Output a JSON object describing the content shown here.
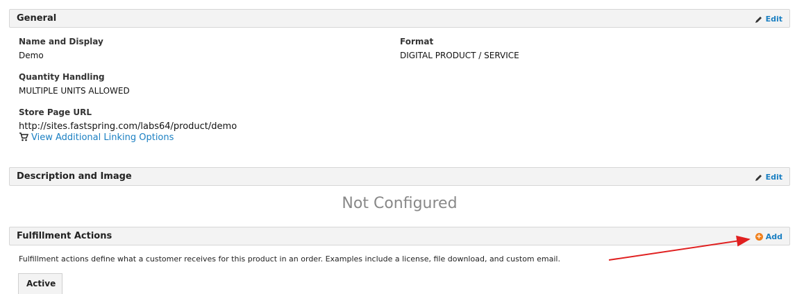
{
  "general": {
    "title": "General",
    "edit_label": "Edit",
    "fields": {
      "name_label": "Name and Display",
      "name_value": "Demo",
      "format_label": "Format",
      "format_value": "DIGITAL PRODUCT / SERVICE",
      "quantity_label": "Quantity Handling",
      "quantity_value": "MULTIPLE UNITS ALLOWED",
      "url_label": "Store Page URL",
      "url_value": "http://sites.fastspring.com/labs64/product/demo",
      "linking_link": "View Additional Linking Options"
    }
  },
  "description": {
    "title": "Description and Image",
    "edit_label": "Edit",
    "status": "Not Configured"
  },
  "fulfillment": {
    "title": "Fulfillment Actions",
    "add_label": "Add",
    "description": "Fulfillment actions define what a customer receives for this product in an order. Examples include a license, file download, and custom email.",
    "tab_active": "Active"
  },
  "colors": {
    "link": "#1a7fc2",
    "add_icon": "#f07f1b",
    "arrow": "#e02020"
  },
  "icons": {
    "edit": "pencil-icon",
    "linking": "cart-icon",
    "add": "plus-circle-icon"
  }
}
